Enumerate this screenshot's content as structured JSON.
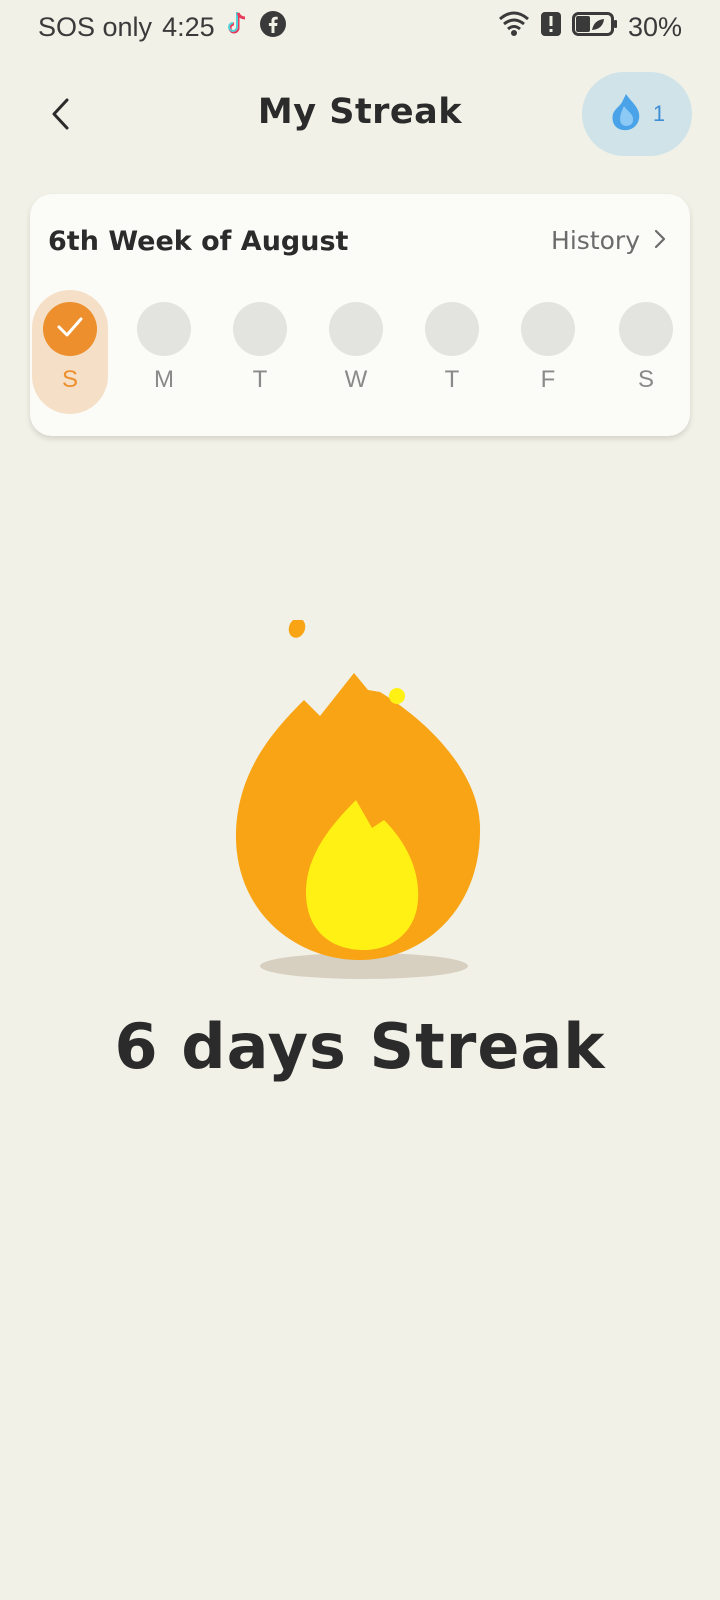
{
  "status_bar": {
    "carrier": "SOS only",
    "time": "4:25",
    "battery": "30%",
    "icons": [
      "tiktok-icon",
      "facebook-icon",
      "wifi-icon",
      "alert-icon",
      "battery-icon"
    ]
  },
  "header": {
    "title": "My Streak",
    "gem_count": "1"
  },
  "week": {
    "title": "6th Week of August",
    "history_label": "History",
    "days": [
      {
        "label": "S",
        "done": true
      },
      {
        "label": "M",
        "done": false
      },
      {
        "label": "T",
        "done": false
      },
      {
        "label": "W",
        "done": false
      },
      {
        "label": "T",
        "done": false
      },
      {
        "label": "F",
        "done": false
      },
      {
        "label": "S",
        "done": false
      }
    ]
  },
  "streak": {
    "text": "6 days Streak"
  },
  "colors": {
    "background": "#f1f1e7",
    "accent": "#ec8f2c",
    "flame_outer": "#f8a415",
    "flame_inner": "#fff114",
    "gem": "#3f8fd6"
  }
}
